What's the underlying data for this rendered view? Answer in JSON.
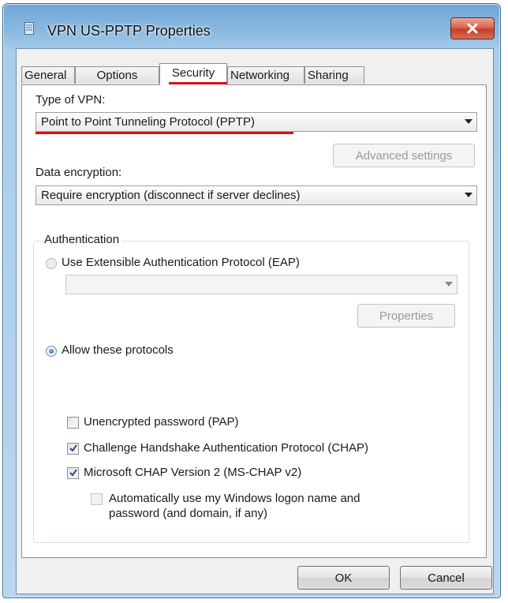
{
  "window": {
    "title": "VPN US-PPTP Properties",
    "close_icon": "close-x-icon"
  },
  "tabs": [
    {
      "label": "General"
    },
    {
      "label": "Options"
    },
    {
      "label": "Security",
      "active": true
    },
    {
      "label": "Networking"
    },
    {
      "label": "Sharing"
    }
  ],
  "security": {
    "vpn_type_label": "Type of VPN:",
    "vpn_type_value": "Point to Point Tunneling Protocol (PPTP)",
    "advanced_settings_label": "Advanced settings",
    "data_encryption_label": "Data encryption:",
    "data_encryption_value": "Require encryption (disconnect if server declines)",
    "authentication": {
      "legend": "Authentication",
      "eap_label": "Use Extensible Authentication Protocol (EAP)",
      "eap_selected": false,
      "eap_method_value": "",
      "properties_label": "Properties",
      "allow_protocols_label": "Allow these protocols",
      "allow_protocols_selected": true,
      "protocols": [
        {
          "label": "Unencrypted password (PAP)",
          "checked": false
        },
        {
          "label": "Challenge Handshake Authentication Protocol (CHAP)",
          "checked": true
        },
        {
          "label": "Microsoft CHAP Version 2 (MS-CHAP v2)",
          "checked": true
        }
      ],
      "auto_logon_line1": "Automatically use my Windows logon name and",
      "auto_logon_line2": "password (and domain, if any)",
      "auto_logon_checked": false
    }
  },
  "buttons": {
    "ok": "OK",
    "cancel": "Cancel"
  },
  "colors": {
    "highlight_underline": "#d8101a",
    "title_bar": "#8fbde3",
    "close_button": "#c6402a"
  }
}
